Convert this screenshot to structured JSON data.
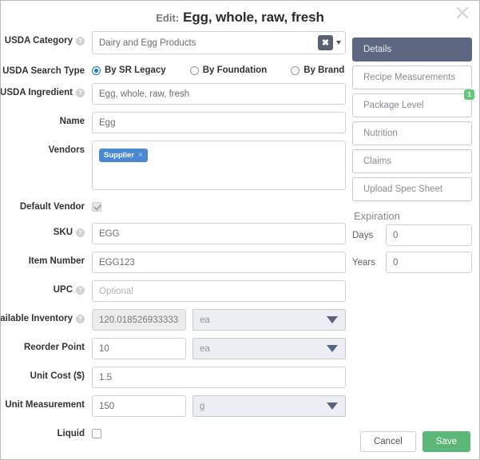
{
  "header": {
    "prefix": "Edit:",
    "title": "Egg, whole, raw, fresh",
    "close_icon": "close-icon"
  },
  "form": {
    "usda_category": {
      "label": "USDA Category",
      "value": "Dairy and Egg Products",
      "clear_label": "✖",
      "has_help": true
    },
    "usda_search_type": {
      "label": "USDA Search Type",
      "options": [
        {
          "label": "By SR Legacy",
          "selected": true
        },
        {
          "label": "By Foundation",
          "selected": false
        },
        {
          "label": "By Brand",
          "selected": false
        }
      ]
    },
    "usda_ingredient": {
      "label": "USDA Ingredient",
      "value": "Egg, whole, raw, fresh",
      "has_help": true
    },
    "name": {
      "label": "Name",
      "value": "Egg"
    },
    "vendors": {
      "label": "Vendors",
      "tags": [
        {
          "label": "Supplier",
          "remove_icon": "×"
        }
      ]
    },
    "default_vendor": {
      "label": "Default Vendor",
      "checked": true,
      "disabled": true
    },
    "sku": {
      "label": "SKU",
      "value": "EGG",
      "has_help": true
    },
    "item_number": {
      "label": "Item Number",
      "value": "EGG123"
    },
    "upc": {
      "label": "UPC",
      "value": "",
      "placeholder": "Optional",
      "has_help": true
    },
    "available_inventory": {
      "label": "Available Inventory",
      "value": "120.0185269333333",
      "unit": "ea",
      "disabled": true,
      "has_help": true
    },
    "reorder_point": {
      "label": "Reorder Point",
      "value": "10",
      "unit": "ea"
    },
    "unit_cost": {
      "label": "Unit Cost ($)",
      "value": "1.5"
    },
    "unit_measurement": {
      "label": "Unit Measurement",
      "value": "150",
      "unit": "g"
    },
    "liquid": {
      "label": "Liquid",
      "checked": false
    }
  },
  "sidebar": {
    "tabs": [
      {
        "label": "Details",
        "active": true
      },
      {
        "label": "Recipe Measurements",
        "active": false
      },
      {
        "label": "Package Level",
        "active": false,
        "badge": "1"
      },
      {
        "label": "Nutrition",
        "active": false
      },
      {
        "label": "Claims",
        "active": false
      },
      {
        "label": "Upload Spec Sheet",
        "active": false
      }
    ],
    "expiration": {
      "title": "Expiration",
      "days": {
        "label": "Days",
        "value": "0"
      },
      "years": {
        "label": "Years",
        "value": "0"
      }
    }
  },
  "footer": {
    "cancel_label": "Cancel",
    "save_label": "Save"
  },
  "colors": {
    "accent_blue": "#1878d4",
    "tag_blue": "#4a88d4",
    "active_tab": "#5e6781",
    "badge_green": "#63c877",
    "save_green": "#5cb878"
  }
}
